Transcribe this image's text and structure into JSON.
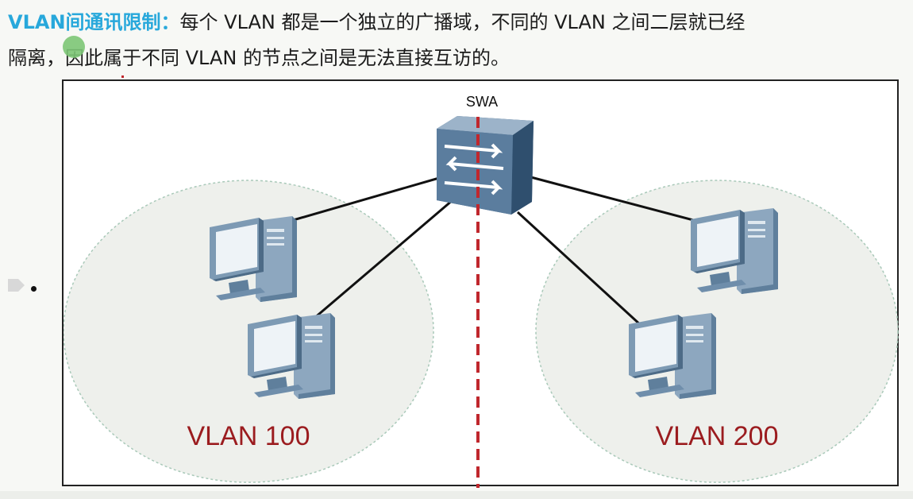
{
  "header": {
    "title": "VLAN间通讯限制：",
    "line1": "每个 VLAN 都是一个独立的广播域，不同的 VLAN 之间二层就已经",
    "line2": "隔离，因此属于不同 VLAN 的节点之间是无法直接互访的。"
  },
  "diagram": {
    "switch_label": "SWA",
    "vlan_left_label": "VLAN 100",
    "vlan_right_label": "VLAN 200"
  },
  "colors": {
    "title": "#28a8db",
    "vlan_label": "#9b1c1f",
    "divider": "#c0272d",
    "switch": "#4a6a8a",
    "pc": "#6f8eab"
  },
  "icons": [
    "switch-icon",
    "pc-icon"
  ]
}
